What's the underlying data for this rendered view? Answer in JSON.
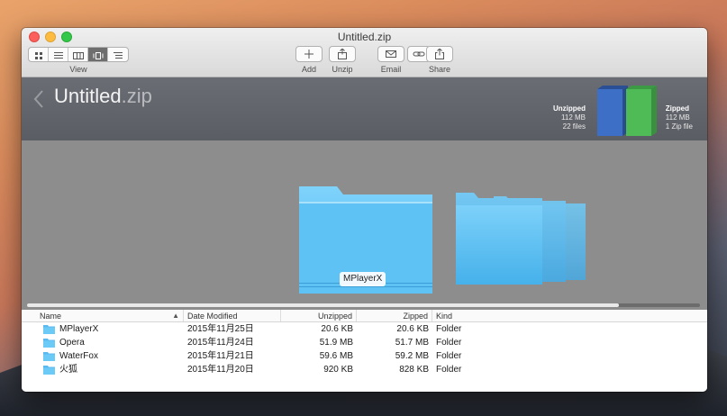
{
  "window": {
    "title": "Untitled.zip"
  },
  "toolbar": {
    "view_label": "View",
    "view_modes": [
      "icons",
      "list",
      "columns",
      "coverflow",
      "outline"
    ],
    "active_view": "coverflow",
    "buttons": [
      {
        "id": "add",
        "label": "Add",
        "icon": "plus-icon"
      },
      {
        "id": "unzip",
        "label": "Unzip",
        "icon": "unzip-icon"
      },
      {
        "id": "email",
        "label": "Email",
        "icon": "envelope-icon"
      },
      {
        "id": "share",
        "label": "Share",
        "icon": "share-icon"
      }
    ]
  },
  "header": {
    "archive_base": "Untitled",
    "archive_ext": ".zip",
    "unzipped": {
      "title": "Unzipped",
      "size": "112 MB",
      "count": "22 files"
    },
    "zipped": {
      "title": "Zipped",
      "size": "112 MB",
      "count": "1 Zip file"
    },
    "colors": {
      "unzipped_bar": "#3d6fc6",
      "zipped_bar": "#4fbb57"
    }
  },
  "preview": {
    "selected_label": "MPlayerX",
    "progress": 0.88,
    "folder_color": "#5ec2f5"
  },
  "table": {
    "columns": {
      "name": "Name",
      "date": "Date Modified",
      "unzipped": "Unzipped",
      "zipped": "Zipped",
      "kind": "Kind"
    },
    "rows": [
      {
        "name": "MPlayerX",
        "date": "2015年11月25日",
        "unzipped": "20.6 KB",
        "zipped": "20.6 KB",
        "kind": "Folder"
      },
      {
        "name": "Opera",
        "date": "2015年11月24日",
        "unzipped": "51.9 MB",
        "zipped": "51.7 MB",
        "kind": "Folder"
      },
      {
        "name": "WaterFox",
        "date": "2015年11月21日",
        "unzipped": "59.6 MB",
        "zipped": "59.2 MB",
        "kind": "Folder"
      },
      {
        "name": "火狐",
        "date": "2015年11月20日",
        "unzipped": "920 KB",
        "zipped": "828 KB",
        "kind": "Folder"
      }
    ]
  }
}
